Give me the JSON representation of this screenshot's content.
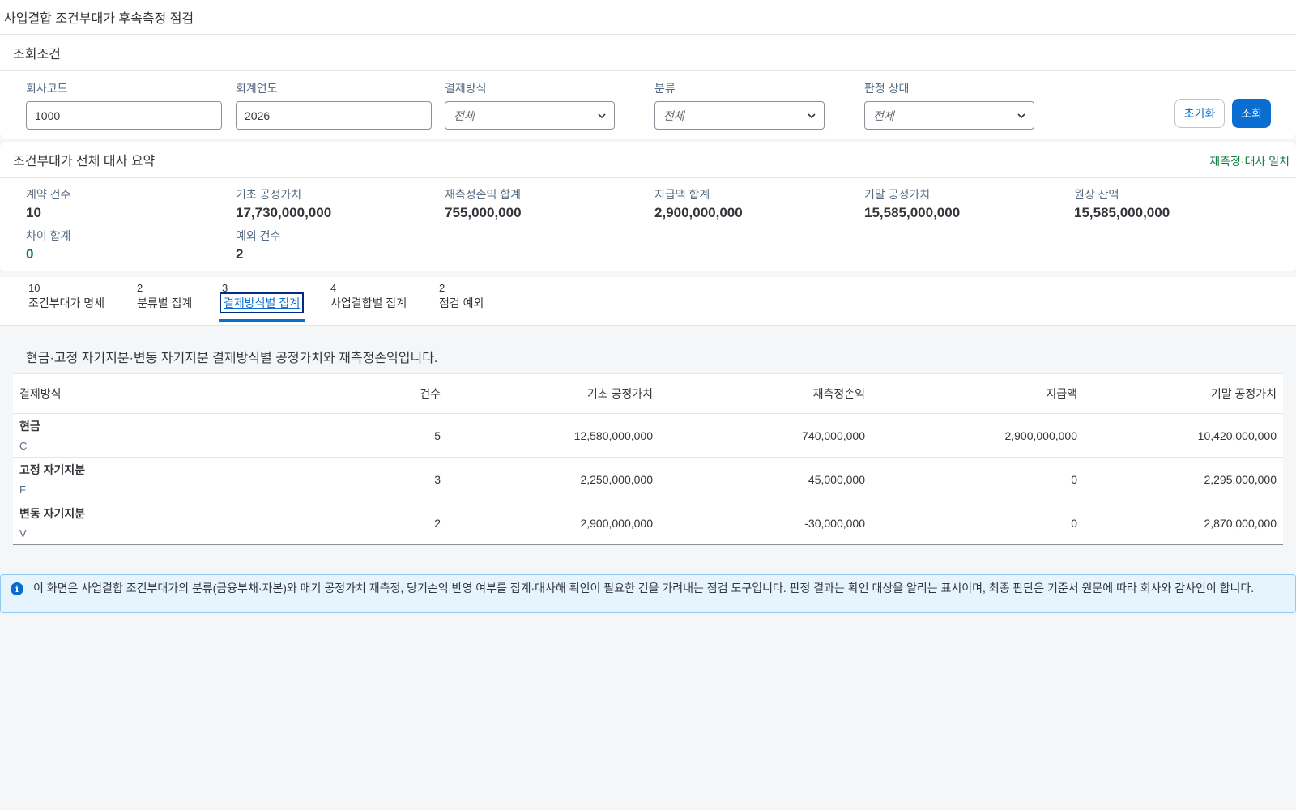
{
  "header": {
    "title": "사업결합 조건부대가 후속측정 점검"
  },
  "filters": {
    "title": "조회조건",
    "company_code": {
      "label": "회사코드",
      "value": "1000"
    },
    "fiscal_year": {
      "label": "회계연도",
      "value": "2026"
    },
    "settlement_method": {
      "label": "결제방식",
      "value": "전체"
    },
    "classification": {
      "label": "분류",
      "value": "전체"
    },
    "judgement_status": {
      "label": "판정 상태",
      "value": "전체"
    },
    "reset_label": "초기화",
    "search_label": "조회"
  },
  "summary": {
    "title": "조건부대가 전체 대사 요약",
    "status": "재측정·대사 일치",
    "kpis": [
      {
        "label": "계약 건수",
        "value": "10"
      },
      {
        "label": "기초 공정가치",
        "value": "17,730,000,000"
      },
      {
        "label": "재측정손익 합계",
        "value": "755,000,000"
      },
      {
        "label": "지급액 합계",
        "value": "2,900,000,000"
      },
      {
        "label": "기말 공정가치",
        "value": "15,585,000,000"
      },
      {
        "label": "원장 잔액",
        "value": "15,585,000,000"
      },
      {
        "label": "차이 합계",
        "value": "0"
      },
      {
        "label": "예외 건수",
        "value": "2"
      }
    ]
  },
  "tabs": [
    {
      "count": "10",
      "label": "조건부대가 명세"
    },
    {
      "count": "2",
      "label": "분류별 집계"
    },
    {
      "count": "3",
      "label": "결제방식별 집계"
    },
    {
      "count": "4",
      "label": "사업결합별 집계"
    },
    {
      "count": "2",
      "label": "점검 예외"
    }
  ],
  "content": {
    "description": "현금·고정 자기지분·변동 자기지분 결제방식별 공정가치와 재측정손익입니다.",
    "columns": [
      "결제방식",
      "건수",
      "기초 공정가치",
      "재측정손익",
      "지급액",
      "기말 공정가치"
    ],
    "rows": [
      {
        "name": "현금",
        "code": "C",
        "count": "5",
        "opening": "12,580,000,000",
        "remeasure": "740,000,000",
        "paid": "2,900,000,000",
        "closing": "10,420,000,000"
      },
      {
        "name": "고정 자기지분",
        "code": "F",
        "count": "3",
        "opening": "2,250,000,000",
        "remeasure": "45,000,000",
        "paid": "0",
        "closing": "2,295,000,000"
      },
      {
        "name": "변동 자기지분",
        "code": "V",
        "count": "2",
        "opening": "2,900,000,000",
        "remeasure": "-30,000,000",
        "paid": "0",
        "closing": "2,870,000,000"
      }
    ]
  },
  "info": {
    "icon": "info-icon",
    "text": "이 화면은 사업결합 조건부대가의 분류(금융부채·자본)와 매기 공정가치 재측정, 당기손익 반영 여부를 집계·대사해 확인이 필요한 건을 가려내는 점검 도구입니다. 판정 결과는 확인 대상을 알리는 표시이며, 최종 판단은 기준서 원문에 따라 회사와 감사인이 합니다."
  }
}
